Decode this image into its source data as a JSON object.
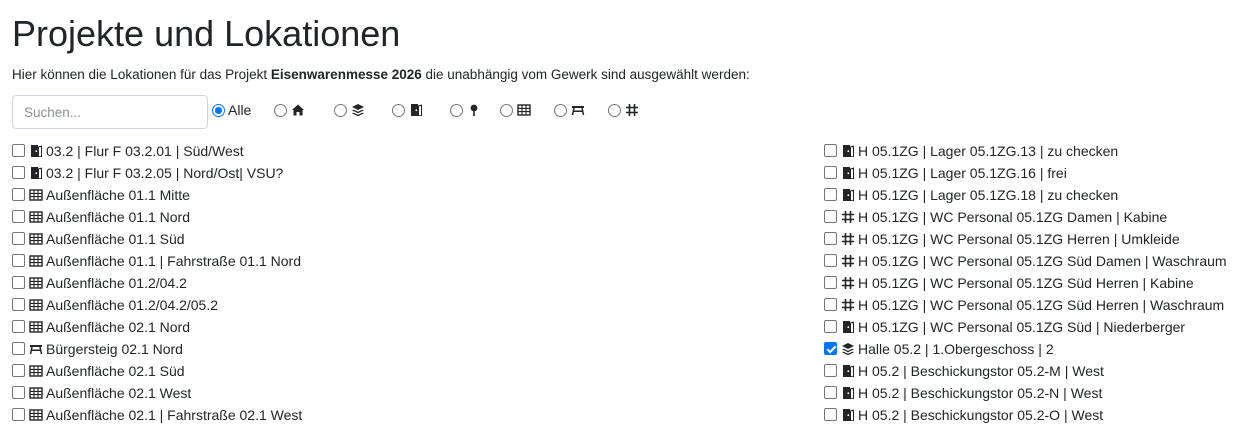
{
  "page": {
    "title": "Projekte und Lokationen",
    "intro_before": "Hier können die Lokationen für das Projekt ",
    "project": "Eisenwarenmesse 2026",
    "intro_after": " die unabhängig vom Gewerk sind ausgewählt werden:"
  },
  "search": {
    "placeholder": "Suchen...",
    "value": ""
  },
  "filters": [
    {
      "label": "Alle",
      "icon": "",
      "selected": true
    },
    {
      "label": "",
      "icon": "house-icon",
      "selected": false
    },
    {
      "label": "",
      "icon": "layers-icon",
      "selected": false
    },
    {
      "label": "",
      "icon": "door-icon",
      "selected": false
    },
    {
      "label": "",
      "icon": "pin-icon",
      "selected": false
    },
    {
      "label": "",
      "icon": "grid-icon",
      "selected": false
    },
    {
      "label": "",
      "icon": "bench-icon",
      "selected": false
    },
    {
      "label": "",
      "icon": "hashtag-icon",
      "selected": false
    }
  ],
  "locations_left": [
    {
      "icon": "door-icon",
      "label": "03.2 | Flur F 03.2.01 | Süd/West",
      "checked": false
    },
    {
      "icon": "door-icon",
      "label": "03.2 | Flur F 03.2.05 | Nord/Ost| VSU?",
      "checked": false
    },
    {
      "icon": "grid-icon",
      "label": "Außenfläche 01.1 Mitte",
      "checked": false
    },
    {
      "icon": "grid-icon",
      "label": "Außenfläche 01.1 Nord",
      "checked": false
    },
    {
      "icon": "grid-icon",
      "label": "Außenfläche 01.1 Süd",
      "checked": false
    },
    {
      "icon": "grid-icon",
      "label": "Außenfläche 01.1 | Fahrstraße 01.1 Nord",
      "checked": false
    },
    {
      "icon": "grid-icon",
      "label": "Außenfläche 01.2/04.2",
      "checked": false
    },
    {
      "icon": "grid-icon",
      "label": "Außenfläche 01.2/04.2/05.2",
      "checked": false
    },
    {
      "icon": "grid-icon",
      "label": "Außenfläche 02.1 Nord",
      "checked": false
    },
    {
      "icon": "bench-icon",
      "label": "Bürgersteig 02.1 Nord",
      "checked": false
    },
    {
      "icon": "grid-icon",
      "label": "Außenfläche 02.1 Süd",
      "checked": false
    },
    {
      "icon": "grid-icon",
      "label": "Außenfläche 02.1 West",
      "checked": false
    },
    {
      "icon": "grid-icon",
      "label": "Außenfläche 02.1 | Fahrstraße 02.1 West",
      "checked": false
    }
  ],
  "locations_right": [
    {
      "icon": "door-icon",
      "label": "H 05.1ZG | Lager 05.1ZG.13 | zu checken",
      "checked": false
    },
    {
      "icon": "door-icon",
      "label": "H 05.1ZG | Lager 05.1ZG.16 | frei",
      "checked": false
    },
    {
      "icon": "door-icon",
      "label": "H 05.1ZG | Lager 05.1ZG.18 | zu checken",
      "checked": false
    },
    {
      "icon": "hashtag-icon",
      "label": "H 05.1ZG | WC Personal 05.1ZG Damen | Kabine",
      "checked": false
    },
    {
      "icon": "hashtag-icon",
      "label": "H 05.1ZG | WC Personal 05.1ZG Herren | Umkleide",
      "checked": false
    },
    {
      "icon": "hashtag-icon",
      "label": "H 05.1ZG | WC Personal 05.1ZG Süd Damen | Waschraum",
      "checked": false
    },
    {
      "icon": "hashtag-icon",
      "label": "H 05.1ZG | WC Personal 05.1ZG Süd Herren | Kabine",
      "checked": false
    },
    {
      "icon": "hashtag-icon",
      "label": "H 05.1ZG | WC Personal 05.1ZG Süd Herren | Waschraum",
      "checked": false
    },
    {
      "icon": "door-icon",
      "label": "H 05.1ZG | WC Personal 05.1ZG Süd | Niederberger",
      "checked": false
    },
    {
      "icon": "layers-icon",
      "label": "Halle 05.2 | 1.Obergeschoss | 2",
      "checked": true
    },
    {
      "icon": "door-icon",
      "label": "H 05.2 | Beschickungstor 05.2-M | West",
      "checked": false
    },
    {
      "icon": "door-icon",
      "label": "H 05.2 | Beschickungstor 05.2-N | West",
      "checked": false
    },
    {
      "icon": "door-icon",
      "label": "H 05.2 | Beschickungstor 05.2-O | West",
      "checked": false
    }
  ],
  "colors": {
    "text": "#212529",
    "accent": "#0075ff",
    "border": "#ced4da"
  }
}
